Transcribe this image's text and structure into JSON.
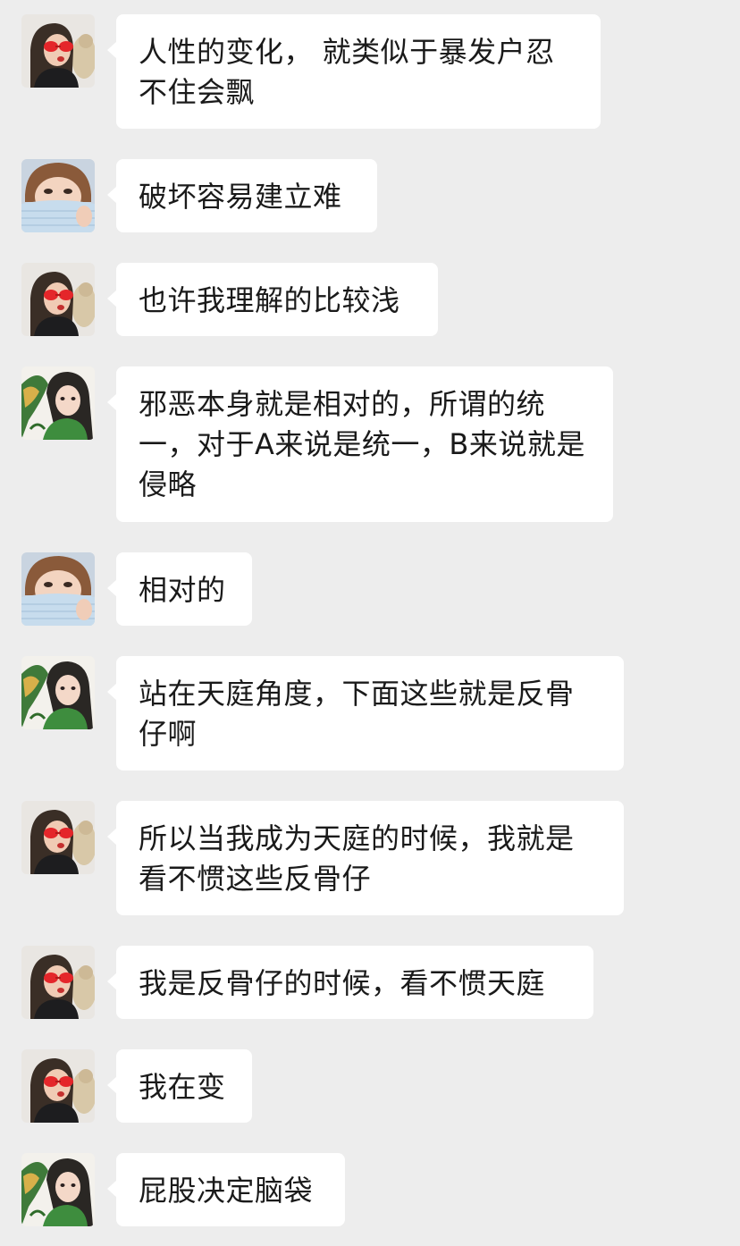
{
  "messages": [
    {
      "sender": "avatar-red-glasses",
      "text": "人性的变化， 就类似于暴发户忍不住会飘"
    },
    {
      "sender": "avatar-towel-girl",
      "text": "破坏容易建立难"
    },
    {
      "sender": "avatar-red-glasses",
      "text": "也许我理解的比较浅"
    },
    {
      "sender": "avatar-dragon-girl",
      "text": "邪恶本身就是相对的，所谓的统一，对于A来说是统一，B来说就是侵略"
    },
    {
      "sender": "avatar-towel-girl",
      "text": "相对的"
    },
    {
      "sender": "avatar-dragon-girl",
      "text": "站在天庭角度，下面这些就是反骨仔啊"
    },
    {
      "sender": "avatar-red-glasses",
      "text": "所以当我成为天庭的时候，我就是看不惯这些反骨仔"
    },
    {
      "sender": "avatar-red-glasses",
      "text": "我是反骨仔的时候，看不惯天庭"
    },
    {
      "sender": "avatar-red-glasses",
      "text": "我在变"
    },
    {
      "sender": "avatar-dragon-girl",
      "text": "屁股决定脑袋"
    }
  ],
  "colors": {
    "background": "#ededed",
    "bubble": "#ffffff",
    "text": "#1a1a1a"
  }
}
